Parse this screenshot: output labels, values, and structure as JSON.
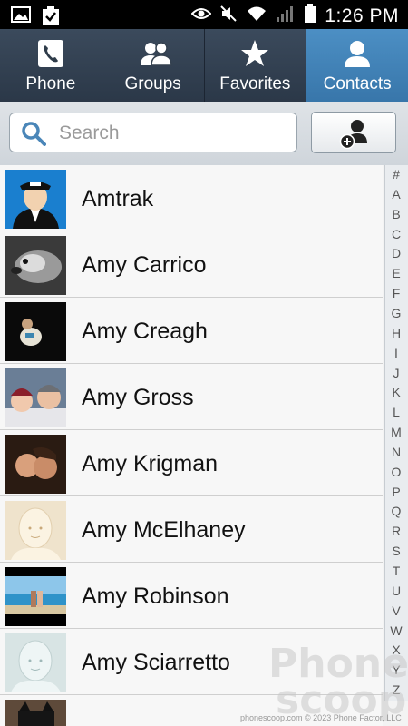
{
  "status": {
    "time": "1:26 PM"
  },
  "tabs": [
    {
      "label": "Phone",
      "icon": "phone-icon"
    },
    {
      "label": "Groups",
      "icon": "groups-icon"
    },
    {
      "label": "Favorites",
      "icon": "star-icon"
    },
    {
      "label": "Contacts",
      "icon": "contact-icon",
      "active": true
    }
  ],
  "search": {
    "placeholder": "Search",
    "value": ""
  },
  "contacts": [
    {
      "name": "Amtrak",
      "avatar": "conductor-photo"
    },
    {
      "name": "Amy Carrico",
      "avatar": "dog-photo"
    },
    {
      "name": "Amy Creagh",
      "avatar": "dark-photo"
    },
    {
      "name": "Amy Gross",
      "avatar": "winter-photo"
    },
    {
      "name": "Amy Krigman",
      "avatar": "couple-photo"
    },
    {
      "name": "Amy McElhaney",
      "avatar": "default-avatar"
    },
    {
      "name": "Amy Robinson",
      "avatar": "beach-photo"
    },
    {
      "name": "Amy Sciarretto",
      "avatar": "default-avatar-blue"
    }
  ],
  "index_letters": [
    "#",
    "A",
    "B",
    "C",
    "D",
    "E",
    "F",
    "G",
    "H",
    "I",
    "J",
    "K",
    "L",
    "M",
    "N",
    "O",
    "P",
    "Q",
    "R",
    "S",
    "T",
    "U",
    "V",
    "W",
    "X",
    "Y",
    "Z"
  ],
  "watermark": {
    "line1": "Phone",
    "line2": "scoop"
  },
  "footer": "phonescoop.com  © 2023 Phone Factor, LLC",
  "colors": {
    "active_tab": "#4686bb",
    "tab_bg": "#34414f",
    "accent": "#3876aa"
  }
}
